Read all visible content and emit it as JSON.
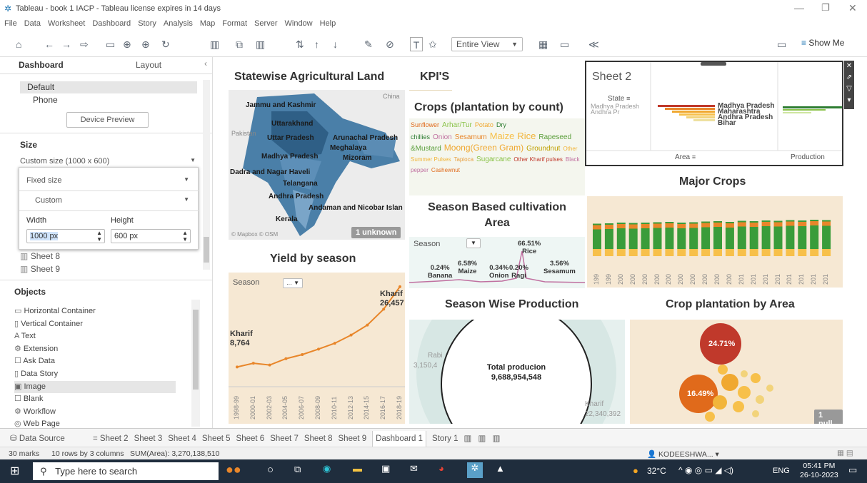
{
  "window": {
    "title": "Tableau - book 1 IACP - Tableau license expires in 14 days"
  },
  "menu": [
    "File",
    "Data",
    "Worksheet",
    "Dashboard",
    "Story",
    "Analysis",
    "Map",
    "Format",
    "Server",
    "Window",
    "Help"
  ],
  "toolbar": {
    "view_select": "Entire View",
    "show_me": "Show Me"
  },
  "sidebar": {
    "tab_dashboard": "Dashboard",
    "tab_layout": "Layout",
    "devices": [
      "Default",
      "Phone"
    ],
    "device_preview": "Device Preview",
    "size_header": "Size",
    "size_value": "Custom size (1000 x 600)",
    "size_mode": "Fixed size",
    "size_preset": "Custom",
    "width_label": "Width",
    "height_label": "Height",
    "width_value": "1000 px",
    "height_value": "600 px",
    "sheets": [
      "Sheet 8",
      "Sheet 9"
    ],
    "objects_header": "Objects",
    "objects": [
      "Horizontal Container",
      "Vertical Container",
      "Text",
      "Extension",
      "Ask Data",
      "Data Story",
      "Image",
      "Blank",
      "Workflow",
      "Web Page"
    ]
  },
  "dashboard": {
    "map_title": "Statewise Agricultural Land",
    "kpi_title": "KPI'S",
    "crops_title": "Crops (plantation by count)",
    "sheet2_title": "Sheet 2",
    "sheet2_state": "State",
    "sheet2_area": "Area",
    "sheet2_production": "Production",
    "major_crops_title": "Major Crops",
    "season_cult_title": "Season Based cultivation",
    "season_cult_title2": "Area",
    "yield_title": "Yield by season",
    "season_prod_title": "Season Wise Production",
    "crop_area_title": "Crop plantation by Area",
    "map_labels": [
      "Jammu and Kashmir",
      "Uttarakhand",
      "Pakistan",
      "Uttar Pradesh",
      "Arunachal Pradesh",
      "Meghalaya",
      "Madhya Pradesh",
      "Mizoram",
      "Dadra and Nagar Haveli",
      "Telangana",
      "Andhra Pradesh",
      "Andaman and Nicobar Islan",
      "Kerala",
      "China"
    ],
    "map_credit": "© Mapbox © OSM",
    "map_unknown": "1 unknown",
    "season_filter": "Season",
    "season_pcts": [
      {
        "pct": "0.24%",
        "name": "Banana"
      },
      {
        "pct": "6.58%",
        "name": "Maize"
      },
      {
        "pct": "0.34%",
        "name": "Onion"
      },
      {
        "pct": "0.20%",
        "name": "Ragi"
      },
      {
        "pct": "66.51%",
        "name": "Rice"
      },
      {
        "pct": "3.56%",
        "name": "Sesamum"
      }
    ],
    "yield_start_label": "Kharif",
    "yield_start_value": "8,764",
    "yield_end_label": "Kharif",
    "yield_end_value": "26,457",
    "total_label": "Total producion",
    "total_value": "9,688,954,548",
    "pie_left": "Rabi",
    "pie_left_val": "3,150,4",
    "pie_right": "Kharif",
    "pie_right_val": "22,340,392",
    "bubble_big": "24.71%",
    "bubble_mid": "16.49%",
    "bubble_null": "1 null",
    "word_cloud": [
      "Sunflower",
      "Arhar/Tur",
      "Potato",
      "Dry chillies",
      "Onion",
      "Sesamum",
      "Maize",
      "Rice",
      "Rapeseed &Mustard",
      "Moong(Green Gram)",
      "Groundnut",
      "Other Summer Pulses",
      "Tapioca",
      "Sugarcane",
      "Other Kharif pulses",
      "Black pepper",
      "Cashewnut"
    ]
  },
  "chart_data": [
    {
      "type": "line",
      "title": "Yield by season",
      "xlabel": "",
      "ylabel": "",
      "x": [
        "1998-99",
        "2000-01",
        "2002-03",
        "2004-05",
        "2006-07",
        "2008-09",
        "2010-11",
        "2012-13",
        "2014-15",
        "2016-17",
        "2018-19"
      ],
      "series": [
        {
          "name": "Kharif",
          "values": [
            8764,
            9600,
            9200,
            10600,
            11500,
            12700,
            14000,
            15800,
            18000,
            21500,
            26457
          ]
        }
      ]
    },
    {
      "type": "bar",
      "title": "Major Crops",
      "categories": [
        "199",
        "199",
        "200",
        "200",
        "200",
        "200",
        "200",
        "200",
        "200",
        "200",
        "200",
        "200",
        "201",
        "201",
        "201",
        "201",
        "201",
        "201",
        "201",
        "201"
      ],
      "series": [
        {
          "name": "",
          "values": [
            55,
            56,
            58,
            57,
            58,
            59,
            60,
            58,
            59,
            61,
            62,
            60,
            63,
            62,
            64,
            63,
            65,
            64,
            66,
            65
          ]
        }
      ]
    }
  ],
  "sheet_tabs": {
    "data_source": "Data Source",
    "tabs": [
      "Sheet 2",
      "Sheet 3",
      "Sheet 4",
      "Sheet 5",
      "Sheet 6",
      "Sheet 7",
      "Sheet 8",
      "Sheet 9",
      "Dashboard 1",
      "Story 1"
    ]
  },
  "status": {
    "marks": "30 marks",
    "dims": "10 rows by 3 columns",
    "sum": "SUM(Area): 3,270,138,510",
    "user": "KODEESHWA..."
  },
  "taskbar": {
    "search": "Type here to search",
    "temp": "32°C",
    "lang": "ENG",
    "time": "05:41 PM",
    "date": "26-10-2023"
  },
  "colors": {
    "accent": "#1f4e79",
    "orange": "#e8862a",
    "green": "#3a9c3a",
    "sand": "#f6e8d3"
  }
}
